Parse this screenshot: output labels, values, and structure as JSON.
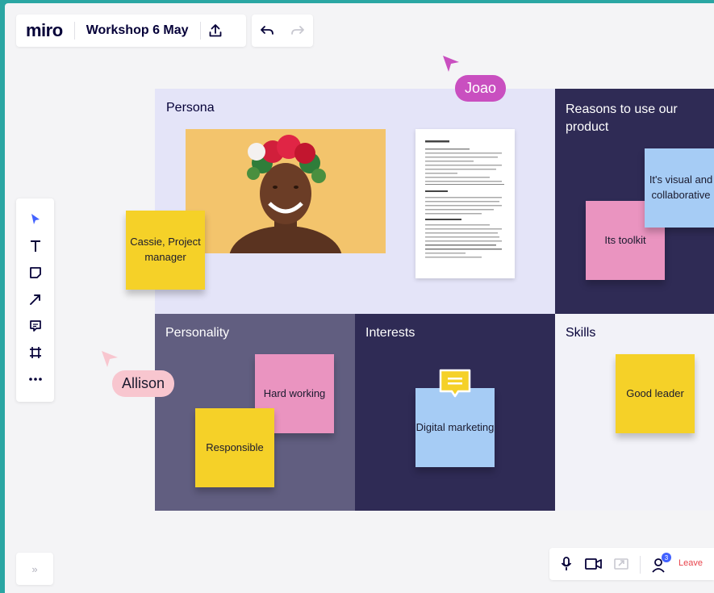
{
  "app": {
    "logo": "miro",
    "board_title": "Workshop 6 May"
  },
  "toolbar": {
    "upload_icon": "upload-icon",
    "undo_icon": "undo-icon",
    "redo_icon": "redo-icon"
  },
  "regions": {
    "persona": "Persona",
    "reasons": "Reasons to use our product",
    "personality": "Personality",
    "interests": "Interests",
    "skills": "Skills"
  },
  "stickies": {
    "cassie": "Cassie, Project manager",
    "visual": "It's visual and collaborative",
    "toolkit": "Its toolkit",
    "hard_working": "Hard working",
    "responsible": "Responsible",
    "digital_marketing": "Digital marketing",
    "good_leader": "Good leader"
  },
  "cursors": [
    {
      "name": "Joao",
      "color": "#c94fc0",
      "text_color": "#ffffff"
    },
    {
      "name": "Allison",
      "color": "#f8c6cf",
      "text_color": "#1a1a2e"
    }
  ],
  "tools": [
    "select-tool",
    "text-tool",
    "sticky-note-tool",
    "arrow-tool",
    "comment-tool",
    "frame-tool",
    "more-tools"
  ],
  "bottom": {
    "expand_label": "»",
    "participants_count": "3",
    "leave_label": "Leave"
  },
  "colors": {
    "yellow": "#f5d128",
    "pink": "#ea94c0",
    "blue": "#a6ccf5",
    "navy": "#2f2b55",
    "lavender": "#e4e4f8",
    "leave_red": "#e8434b",
    "accent_blue": "#4262ff"
  }
}
